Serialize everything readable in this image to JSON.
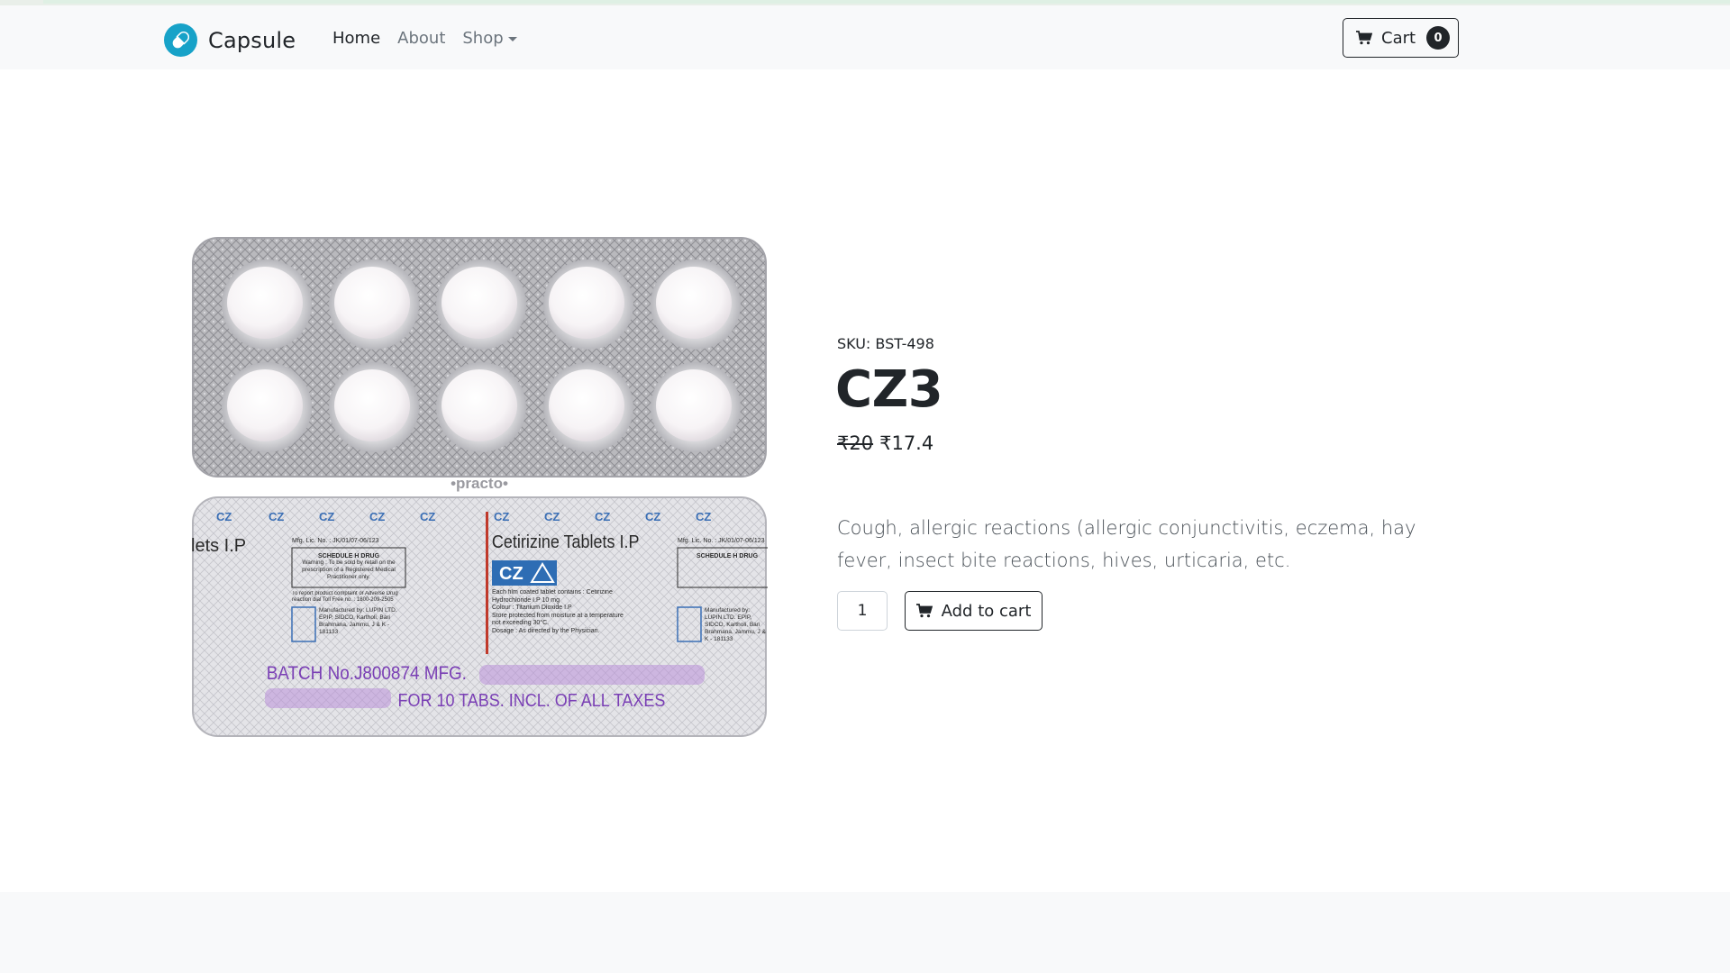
{
  "navbar": {
    "brand": "Capsule",
    "links": [
      {
        "label": "Home",
        "active": true
      },
      {
        "label": "About",
        "active": false
      },
      {
        "label": "Shop",
        "active": false,
        "dropdown": true
      }
    ],
    "cart": {
      "label": "Cart",
      "count": "0"
    }
  },
  "product": {
    "sku": "SKU: BST-498",
    "title": "CZ3",
    "price_old": "₹20",
    "price_new": "₹17.4",
    "description": "Cough, allergic reactions (allergic conjunctivitis, eczema, hay fever, insect bite reactions, hives, urticaria, etc.",
    "quantity": "1",
    "add_to_cart_label": "Add to cart",
    "image": {
      "watermark": "•practo•",
      "pack": {
        "cz_logo": "CZ",
        "drug_name": "Cetirizine Tablets I.P",
        "partial_name": "lets I.P",
        "mfg_lic": "Mfg. Lic. No. : JK/01/07-06/123",
        "schedule": "SCHEDULE H DRUG",
        "warning": "Warning : To be sold by retail on the prescription of a Registered Medical Practitioner only.",
        "report": "To report product complaint or Adverse Drug reaction dial Toll Free no. : 1800-209-2505",
        "manufacturer": "Manufactured by: LUPIN LTD. EPIP, SIDCO, Kartholi, Bari Brahmana, Jammu, J & K - 181133",
        "contains": "Each film coated tablet contains : Cetirizine Hydrochloride I.P 10 mg",
        "colour": "Colour : Titanium Dioxide I.P",
        "storage": "Store protected from moisture at a temperature not exceeding 30°C.",
        "dosage": "Dosage : As directed by the Physician.",
        "batch": "BATCH No.J800874  MFG.",
        "mrp": "FOR 10 TABS. INCL. OF ALL TAXES"
      }
    }
  },
  "colors": {
    "brand_logo": "#17a2c8",
    "navbar_bg": "#f8f9fa",
    "text": "#212529",
    "muted": "#6c757d",
    "batch_ink": "#7a3fb5"
  }
}
